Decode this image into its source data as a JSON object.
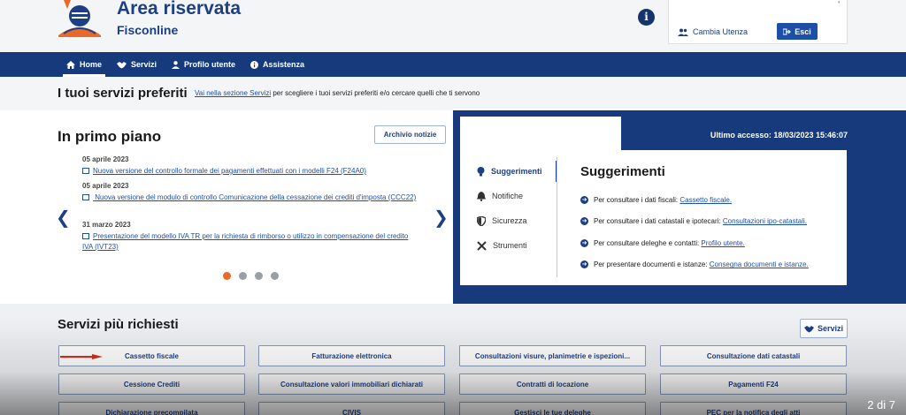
{
  "header": {
    "title": "Area riservata",
    "subtitle": "Fisconline",
    "user_box": {
      "tick": "'",
      "cambia_label": "Cambia Utenza",
      "esci_label": "Esci"
    },
    "info_symbol": "i"
  },
  "nav": {
    "items": [
      {
        "label": "Home",
        "icon": "home-icon",
        "active": true
      },
      {
        "label": "Servizi",
        "icon": "handshake-icon",
        "active": false
      },
      {
        "label": "Profilo utente",
        "icon": "user-icon",
        "active": false
      },
      {
        "label": "Assistenza",
        "icon": "info-icon",
        "active": false
      }
    ]
  },
  "preferiti": {
    "title": "I tuoi servizi preferiti",
    "link": "Vai nella sezione Servizi",
    "text": " per scegliere i tuoi servizi preferiti e/o cercare quelli che ti servono"
  },
  "primo_piano": {
    "title": "In primo piano",
    "archivio_label": "Archivio notizie",
    "news": [
      {
        "date": "05 aprile 2023",
        "text": "Nuova versione del controllo formale dei pagamenti effettuati con i modelli F24 (F24A0)"
      },
      {
        "date": "05 aprile 2023",
        "text": " Nuova versione del modulo di controllo Comunicazione della cessazione dei crediti d'imposta (CCC22)"
      },
      {
        "date": "31 marzo 2023",
        "text": "Presentazione del modello IVA TR per la richiesta di rimborso o utilizzo in compensazione del credito IVA (IVT23)"
      }
    ],
    "carousel": {
      "count": 4,
      "active": 0
    }
  },
  "suggerimenti_panel": {
    "last_access": "Ultimo accesso: 18/03/2023 15:46:07",
    "menu": [
      {
        "label": "Suggerimenti",
        "icon": "lightbulb-icon",
        "active": true
      },
      {
        "label": "Notifiche",
        "icon": "bell-icon",
        "active": false
      },
      {
        "label": "Sicurezza",
        "icon": "shield-icon",
        "active": false
      },
      {
        "label": "Strumenti",
        "icon": "tools-icon",
        "active": false
      }
    ],
    "title": "Suggerimenti",
    "rows": [
      {
        "text": "Per consultare i dati fiscali: ",
        "link": "Cassetto fiscale."
      },
      {
        "text": "Per consultare i dati catastali e ipotecari: ",
        "link": "Consultazioni ipo-catastali."
      },
      {
        "text": "Per consultare deleghe e contatti: ",
        "link": "Profilo utente."
      },
      {
        "text": "Per presentare documenti e istanze: ",
        "link": "Consegna documenti e istanze."
      }
    ]
  },
  "servizi": {
    "title": "Servizi più richiesti",
    "button_label": "Servizi",
    "tiles": [
      "Cassetto fiscale",
      "Fatturazione elettronica",
      "Consultazioni visure, planimetrie e ispezioni...",
      "Consultazione dati catastali",
      "Cessione Crediti",
      "Consultazione valori immobiliari dichiarati",
      "Contratti di locazione",
      "Pagamenti F24",
      "Dichiarazione precompilata",
      "CIVIS",
      "Gestisci le tue deleghe",
      "PEC per la notifica degli atti"
    ]
  },
  "overlay": {
    "counter": "2 di 7"
  },
  "colors": {
    "brand_blue": "#173a7c",
    "link_blue": "#1d4fa8",
    "accent_orange": "#e8692b"
  }
}
